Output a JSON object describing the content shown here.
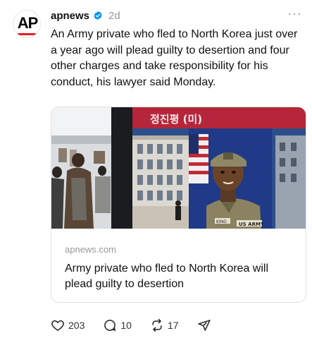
{
  "post": {
    "username": "apnews",
    "timestamp": "2d",
    "avatar_text": "AP",
    "more_label": "···",
    "caption": "An Army private who fled to North Korea just over a year ago will plead guilty to desertion and four other charges and take responsibility for his conduct, his lawyer said Monday."
  },
  "link_card": {
    "domain": "apnews.com",
    "title": "Army private who fled to North Korea will plead guilty to desertion",
    "image_overlay_text": "정진평 (미)",
    "image_badge_text": "KING",
    "image_name_text": "US ARMY"
  },
  "actions": {
    "likes": "203",
    "replies": "10",
    "reposts": "17"
  },
  "colors": {
    "verified": "#0095f6",
    "ap_red": "#e41e26",
    "muted": "#999999"
  },
  "icons": [
    "ap-logo",
    "verified-icon",
    "more-icon",
    "heart-icon",
    "comment-icon",
    "repost-icon",
    "share-icon"
  ]
}
